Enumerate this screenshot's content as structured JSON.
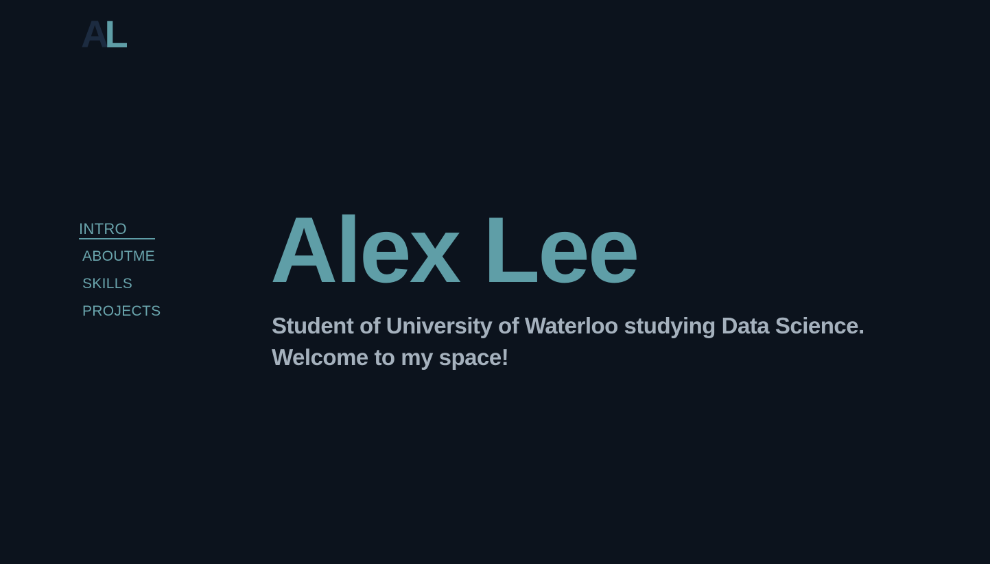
{
  "logo": {
    "letter_a": "A",
    "letter_l": "L"
  },
  "nav": {
    "items": [
      {
        "label": "INTRO",
        "active": true
      },
      {
        "label": "ABOUTME",
        "active": false
      },
      {
        "label": "SKILLS",
        "active": false
      },
      {
        "label": "PROJECTS",
        "active": false
      }
    ]
  },
  "hero": {
    "name": "Alex Lee",
    "line1": "Student of University of Waterloo studying Data Science.",
    "line2": "Welcome to my space!"
  },
  "colors": {
    "background": "#0c131d",
    "accent": "#5f9ea7",
    "logo_dark": "#1c2b40",
    "subtitle": "#a5b1bd"
  }
}
